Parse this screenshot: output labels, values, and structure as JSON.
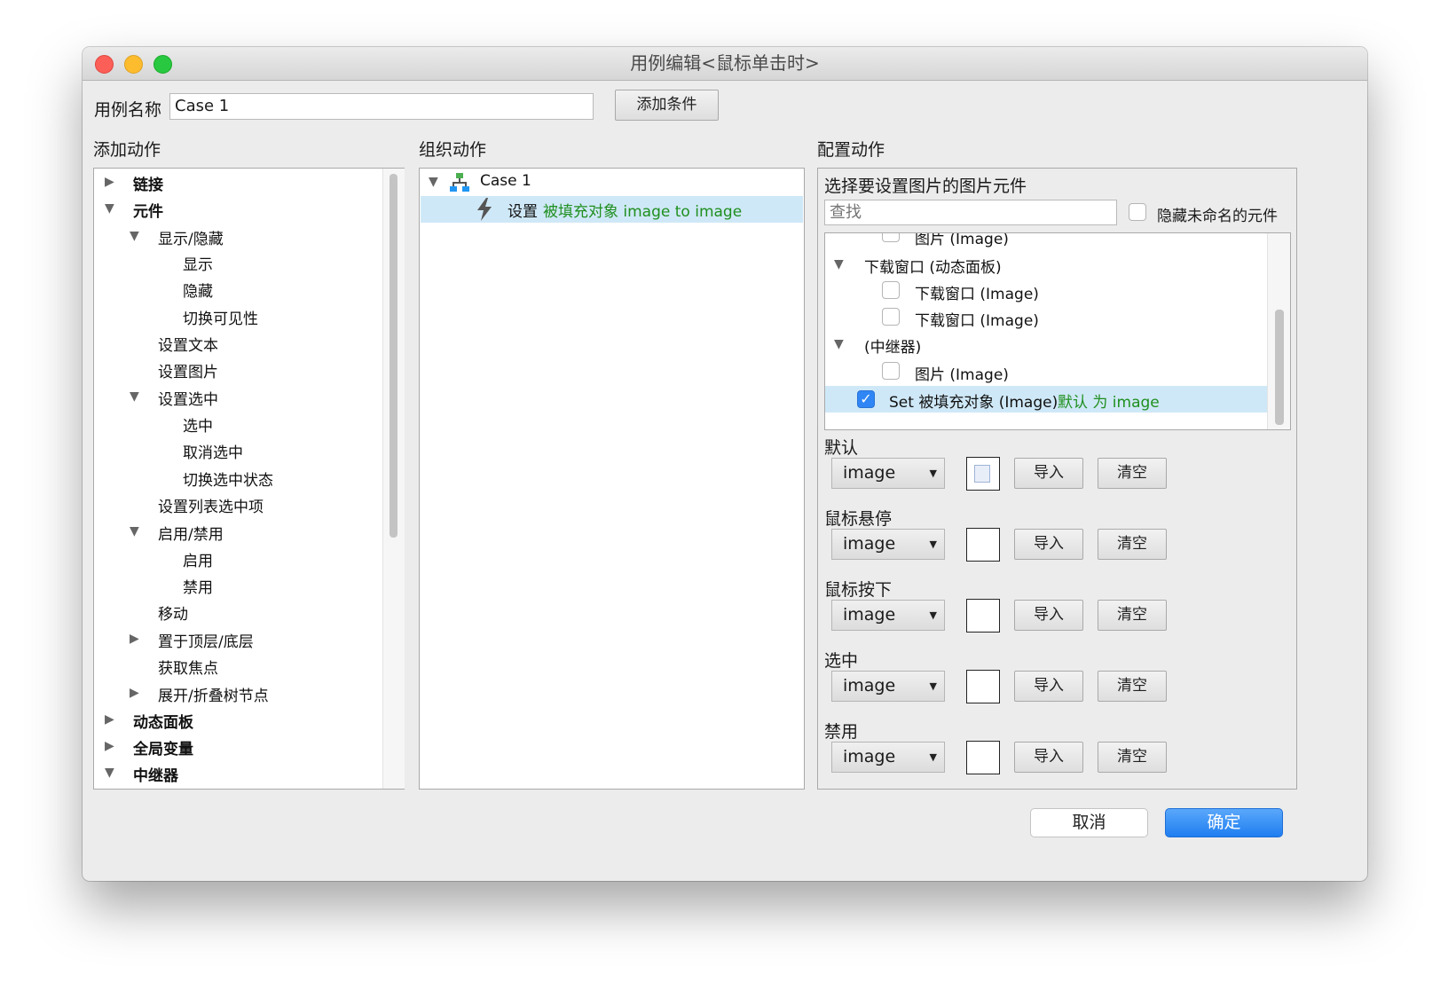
{
  "window": {
    "title": "用例编辑<鼠标单击时>"
  },
  "case_name": {
    "label": "用例名称",
    "value": "Case 1",
    "add_condition": "添加条件"
  },
  "columns": {
    "add_action": "添加动作",
    "organize_action": "组织动作",
    "configure_action": "配置动作"
  },
  "add_tree": [
    {
      "label": "链接",
      "bold": true
    },
    {
      "label": "元件",
      "bold": true
    },
    {
      "label": "显示/隐藏"
    },
    {
      "label": "显示"
    },
    {
      "label": "隐藏"
    },
    {
      "label": "切换可见性"
    },
    {
      "label": "设置文本"
    },
    {
      "label": "设置图片"
    },
    {
      "label": "设置选中"
    },
    {
      "label": "选中"
    },
    {
      "label": "取消选中"
    },
    {
      "label": "切换选中状态"
    },
    {
      "label": "设置列表选中项"
    },
    {
      "label": "启用/禁用"
    },
    {
      "label": "启用"
    },
    {
      "label": "禁用"
    },
    {
      "label": "移动"
    },
    {
      "label": "置于顶层/底层"
    },
    {
      "label": "获取焦点"
    },
    {
      "label": "展开/折叠树节点"
    },
    {
      "label": "动态面板",
      "bold": true
    },
    {
      "label": "全局变量",
      "bold": true
    },
    {
      "label": "中继器",
      "bold": true
    }
  ],
  "organize": {
    "case_label": "Case 1",
    "action_prefix": "设置",
    "action_detail": "被填充对象 image to image"
  },
  "configure": {
    "heading": "选择要设置图片的图片元件",
    "search_placeholder": "查找",
    "hide_unnamed": "隐藏未命名的元件",
    "tree": [
      {
        "label": "图片 (Image)"
      },
      {
        "label": "下载窗口 (动态面板)"
      },
      {
        "label": "下载窗口 (Image)"
      },
      {
        "label": "下载窗口 (Image)"
      },
      {
        "label": "(中继器)"
      },
      {
        "label": "图片 (Image)"
      }
    ],
    "selected_row": {
      "prefix": "Set 被填充对象 (Image)",
      "suffix": "默认 为 image"
    },
    "states": [
      {
        "label": "默认",
        "select": "image",
        "import": "导入",
        "clear": "清空"
      },
      {
        "label": "鼠标悬停",
        "select": "image",
        "import": "导入",
        "clear": "清空"
      },
      {
        "label": "鼠标按下",
        "select": "image",
        "import": "导入",
        "clear": "清空"
      },
      {
        "label": "选中",
        "select": "image",
        "import": "导入",
        "clear": "清空"
      },
      {
        "label": "禁用",
        "select": "image",
        "import": "导入",
        "clear": "清空"
      }
    ]
  },
  "footer": {
    "cancel": "取消",
    "ok": "确定"
  },
  "colors": {
    "accent": "#2f86f4",
    "selection": "#cfe8f7",
    "green_text": "#1f8f1f"
  }
}
